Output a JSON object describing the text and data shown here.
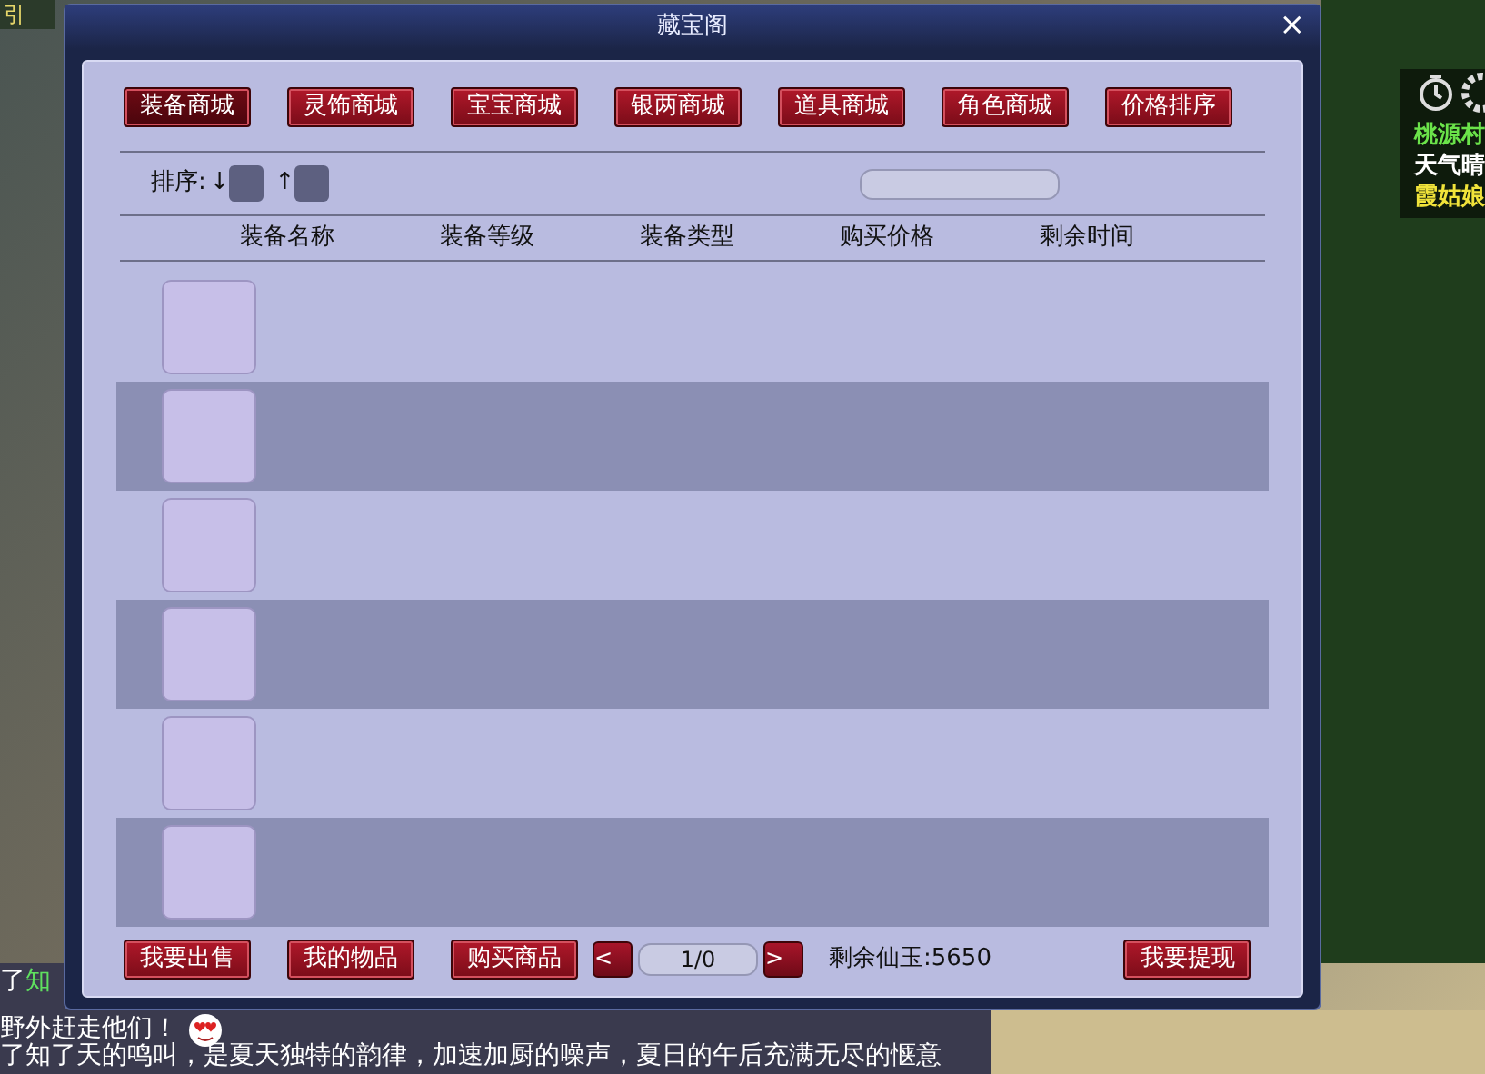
{
  "window": {
    "title": "藏宝阁",
    "close": "×"
  },
  "tabs": [
    {
      "label": "装备商城",
      "selected": true
    },
    {
      "label": "灵饰商城",
      "selected": false
    },
    {
      "label": "宝宝商城",
      "selected": false
    },
    {
      "label": "银两商城",
      "selected": false
    },
    {
      "label": "道具商城",
      "selected": false
    },
    {
      "label": "角色商城",
      "selected": false
    },
    {
      "label": "价格排序",
      "selected": false
    }
  ],
  "sort": {
    "label": "排序:",
    "down": "↓",
    "down_checked": false,
    "up": "↑",
    "up_checked": false
  },
  "table": {
    "columns": [
      "装备名称",
      "装备等级",
      "装备类型",
      "购买价格",
      "剩余时间"
    ],
    "rows": [
      {
        "kind": "empty"
      },
      {
        "kind": "empty"
      },
      {
        "kind": "empty"
      },
      {
        "kind": "empty"
      },
      {
        "kind": "empty"
      },
      {
        "kind": "empty"
      }
    ]
  },
  "footer": {
    "buttons": [
      "我要出售",
      "我的物品",
      "购买商品"
    ],
    "prev": "<",
    "page": "1/0",
    "next": ">",
    "balance": "剩余仙玉:5650",
    "withdraw": "我要提现"
  },
  "hud": {
    "corner": "引",
    "location": "桃源村",
    "weather": "天气晴",
    "npc": "霞姑娘"
  },
  "chat": [
    {
      "text": "了**知**"
    },
    {
      "text": "野外赶走他们！"
    },
    {
      "text": "了知了天的鸣叫，是夏天独特的韵律，加速加厨的噪声，夏日的午后充满无尽的惬意"
    }
  ]
}
